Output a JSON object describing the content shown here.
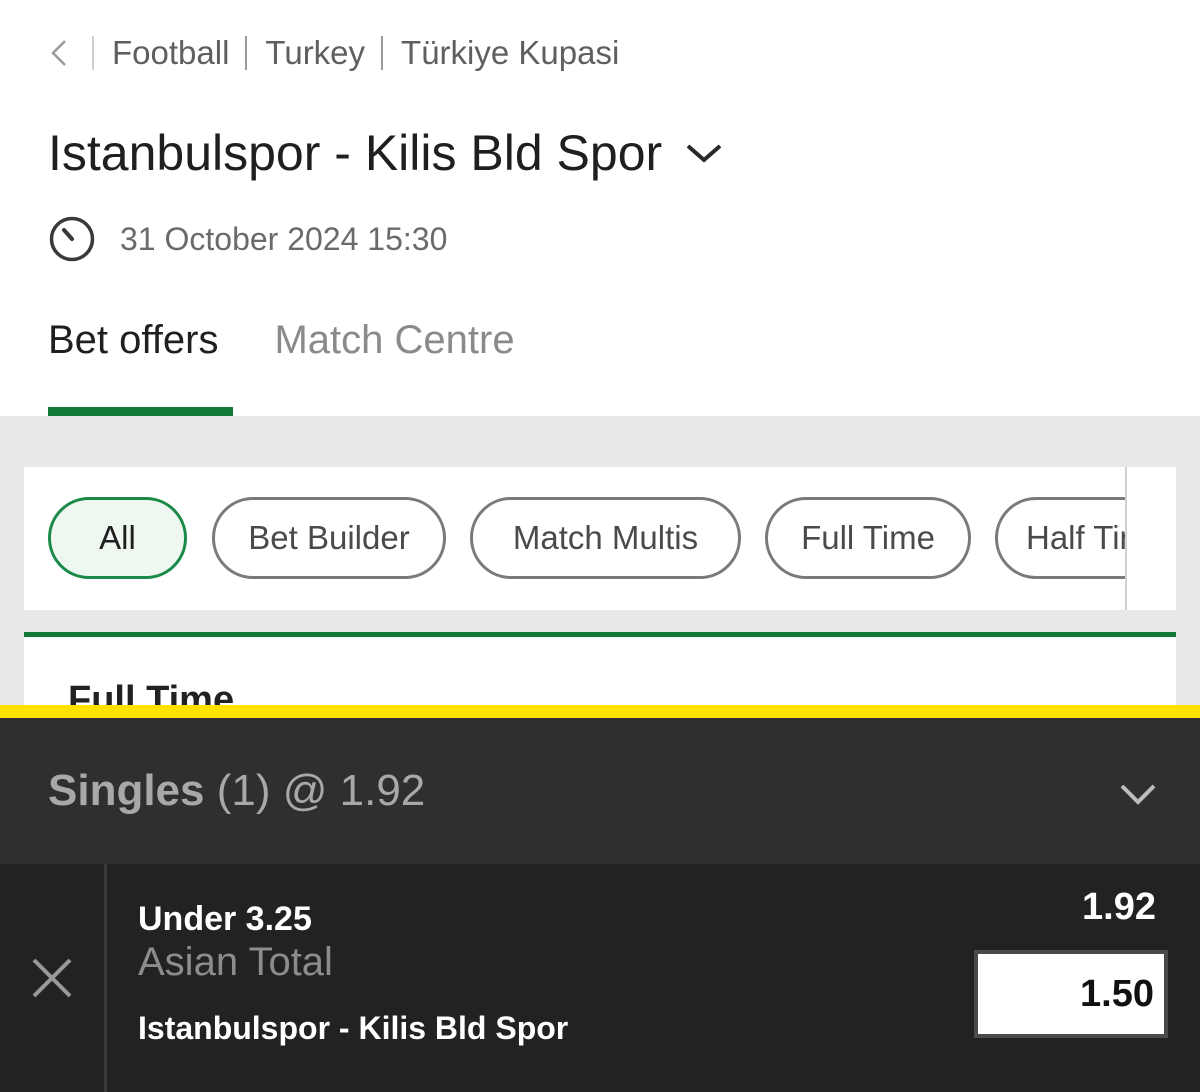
{
  "breadcrumb": {
    "back_icon": "chevron-left-icon",
    "items": [
      "Football",
      "Turkey",
      "Türkiye Kupasi"
    ]
  },
  "match": {
    "title": "Istanbulspor - Kilis Bld Spor",
    "datetime": "31 October 2024 15:30",
    "clock_icon": "clock-icon"
  },
  "tabs": [
    {
      "label": "Bet offers",
      "active": true
    },
    {
      "label": "Match Centre",
      "active": false
    }
  ],
  "filters": [
    {
      "label": "All",
      "active": true
    },
    {
      "label": "Bet Builder",
      "active": false
    },
    {
      "label": "Match Multis",
      "active": false
    },
    {
      "label": "Full Time",
      "active": false
    },
    {
      "label": "Half Time",
      "active": false
    }
  ],
  "section": {
    "title": "Full Time"
  },
  "betslip": {
    "type": "Singles",
    "count": "(1)",
    "total_odds": "@ 1.92",
    "selection": {
      "name": "Under 3.25",
      "market": "Asian Total",
      "event": "Istanbulspor - Kilis Bld Spor",
      "odds": "1.92",
      "stake": "1.50"
    }
  },
  "colors": {
    "accent_green": "#117a36",
    "slip_accent_yellow": "#ffe200",
    "slip_background": "#2f2f2f"
  }
}
